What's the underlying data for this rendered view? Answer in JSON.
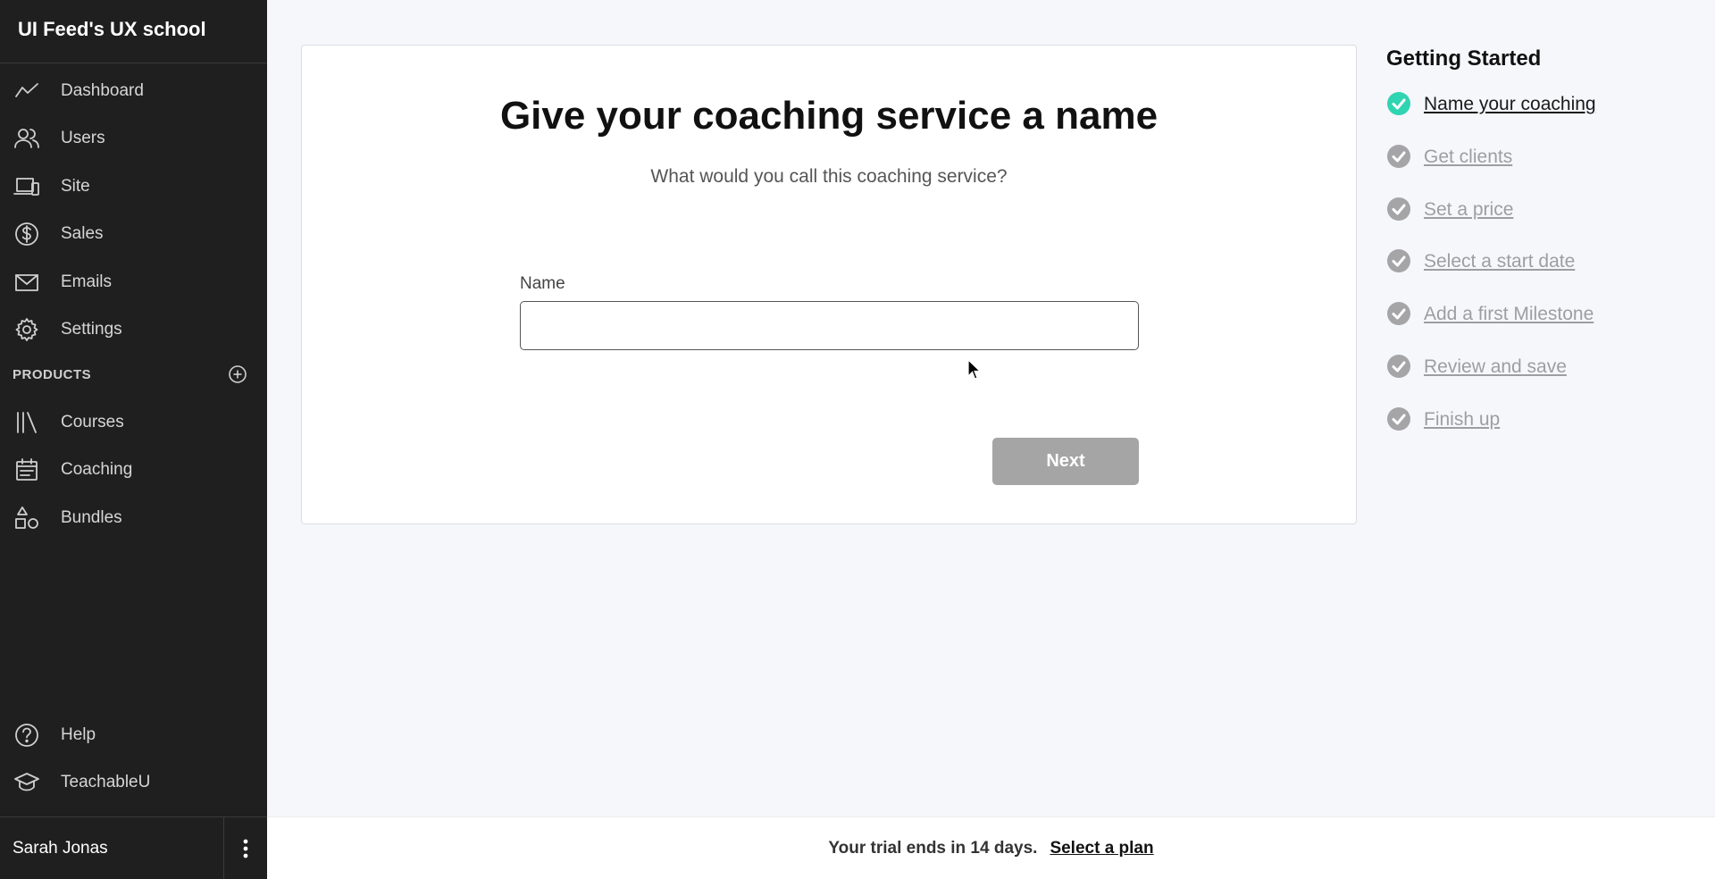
{
  "sidebar": {
    "school_name": "UI Feed's UX school",
    "items": [
      {
        "label": "Dashboard",
        "icon": "trend-line-icon"
      },
      {
        "label": "Users",
        "icon": "users-icon"
      },
      {
        "label": "Site",
        "icon": "devices-icon"
      },
      {
        "label": "Sales",
        "icon": "dollar-circle-icon"
      },
      {
        "label": "Emails",
        "icon": "envelope-icon"
      },
      {
        "label": "Settings",
        "icon": "gear-icon"
      }
    ],
    "products_header": "PRODUCTS",
    "products": [
      {
        "label": "Courses",
        "icon": "library-icon"
      },
      {
        "label": "Coaching",
        "icon": "calendar-icon"
      },
      {
        "label": "Bundles",
        "icon": "shapes-icon"
      }
    ],
    "bottom_items": [
      {
        "label": "Help",
        "icon": "question-circle-icon"
      },
      {
        "label": "TeachableU",
        "icon": "graduation-cap-icon"
      }
    ],
    "user_name": "Sarah Jonas"
  },
  "main": {
    "title": "Give your coaching service a name",
    "subtitle": "What would you call this coaching service?",
    "field_label": "Name",
    "field_value": "",
    "field_placeholder": "",
    "next_label": "Next"
  },
  "getting_started": {
    "title": "Getting Started",
    "steps": [
      {
        "label": "Name your coaching",
        "status": "active"
      },
      {
        "label": "Get clients",
        "status": "pending"
      },
      {
        "label": "Set a price",
        "status": "pending"
      },
      {
        "label": "Select a start date",
        "status": "pending"
      },
      {
        "label": "Add a first Milestone",
        "status": "pending"
      },
      {
        "label": "Review and save",
        "status": "pending"
      },
      {
        "label": "Finish up",
        "status": "pending"
      }
    ]
  },
  "trial": {
    "text": "Your trial ends in 14 days.",
    "link": "Select a plan"
  },
  "colors": {
    "sidebar_bg": "#1f1f1f",
    "active_check": "#2fd4b1",
    "pending_check": "#a5a5a8",
    "button_disabled": "#a5a5a5"
  }
}
